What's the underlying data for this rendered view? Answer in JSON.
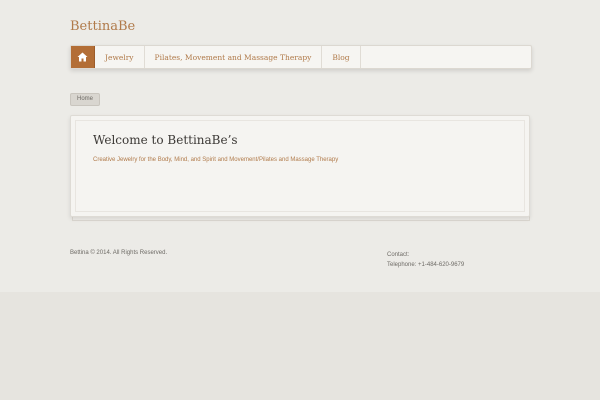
{
  "site": {
    "title": "BettinaBe"
  },
  "nav": {
    "home_icon": "home-icon",
    "items": [
      {
        "label": "Jewelry"
      },
      {
        "label": "Pilates, Movement and Massage Therapy"
      },
      {
        "label": "Blog"
      }
    ],
    "active_color": "#b36e36"
  },
  "breadcrumb": {
    "label": "Home"
  },
  "main": {
    "title": "Welcome to BettinaBe’s",
    "subtitle": "Creative Jewelry for the Body, Mind, and Spirit and Movement/Pilates and Massage Therapy"
  },
  "footer": {
    "copyright": "Bettina © 2014. All Rights Reserved.",
    "contact_label": "Contact:",
    "telephone": "Telephone: +1-484-620-9679"
  },
  "colors": {
    "accent": "#b07a4a",
    "background": "#ebe9e5"
  }
}
